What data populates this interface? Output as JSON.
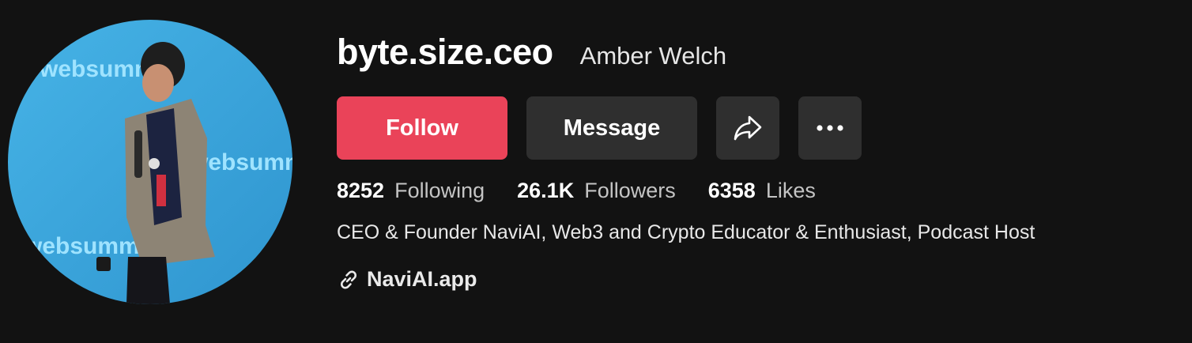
{
  "profile": {
    "username": "byte.size.ceo",
    "display_name": "Amber Welch",
    "avatar_alt": "profile-photo",
    "avatar_backdrop_text": "websummit"
  },
  "actions": {
    "follow_label": "Follow",
    "message_label": "Message",
    "share_icon": "share-arrow-icon",
    "more_icon": "more-dots-icon"
  },
  "stats": [
    {
      "value": "8252",
      "label": "Following"
    },
    {
      "value": "26.1K",
      "label": "Followers"
    },
    {
      "value": "6358",
      "label": "Likes"
    }
  ],
  "bio": "CEO & Founder NaviAI, Web3 and Crypto Educator & Enthusiast, Podcast Host",
  "link": {
    "icon": "link-icon",
    "text": "NaviAI.app"
  },
  "colors": {
    "background": "#121212",
    "follow_button": "#ea4359",
    "secondary_button": "#2f2f2f",
    "avatar_backdrop": "#3aa5dc"
  }
}
